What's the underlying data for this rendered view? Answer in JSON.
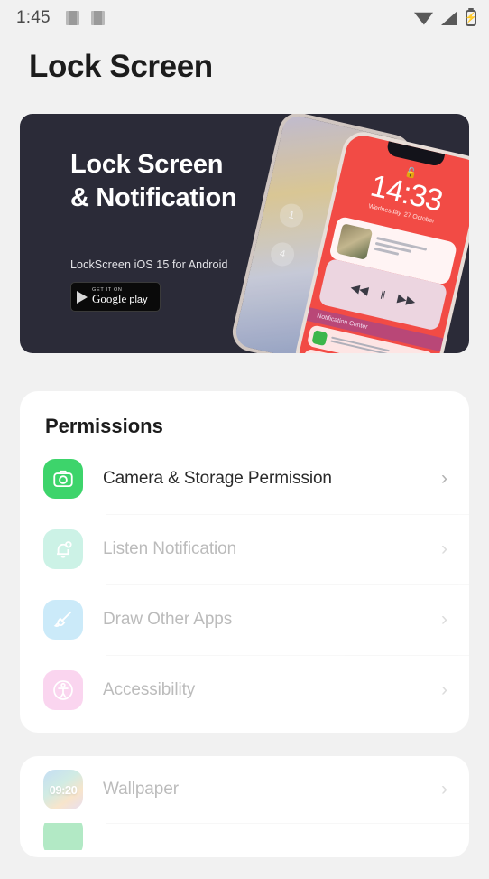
{
  "status_bar": {
    "time": "1:45",
    "left_icons": [
      "notification-glyph",
      "notification-glyph"
    ],
    "right_icons": [
      "wifi-icon",
      "signal-icon",
      "battery-charging-icon"
    ],
    "battery_glyph": "⚡"
  },
  "header": {
    "title": "Lock Screen"
  },
  "banner": {
    "title_line1": "Lock Screen",
    "title_line2": "& Notification",
    "subtitle": "LockScreen iOS 15 for Android",
    "badge": {
      "small_text": "GET IT ON",
      "brand": "Google",
      "brand_light": "play"
    },
    "phone_preview": {
      "time": "14:33",
      "date": "Wednesday, 27 October",
      "lock_glyph": "🔓",
      "notification_center_label": "Notification Center",
      "prev_glyph": "◀◀",
      "pause_glyph": "‖",
      "next_glyph": "▶▶",
      "back_badges": [
        "1",
        "4"
      ]
    }
  },
  "permissions_card": {
    "title": "Permissions",
    "rows": [
      {
        "label": "Camera & Storage Permission",
        "icon": "camera-icon",
        "icon_class": "ico-cam",
        "glyph": "◎",
        "dim": false
      },
      {
        "label": "Listen Notification",
        "icon": "bell-icon",
        "icon_class": "ico-bell",
        "glyph": "🔔",
        "dim": true
      },
      {
        "label": "Draw Other Apps",
        "icon": "brush-icon",
        "icon_class": "ico-brush",
        "glyph": "🖌",
        "dim": true
      },
      {
        "label": "Accessibility",
        "icon": "accessibility-icon",
        "icon_class": "ico-acc",
        "glyph": "♿",
        "dim": true
      }
    ]
  },
  "settings_card": {
    "rows": [
      {
        "label": "Wallpaper",
        "icon": "wallpaper-thumbnail-icon",
        "icon_class": "ico-wall",
        "glyph": "09:20",
        "dim": true
      }
    ]
  },
  "chevron": "›"
}
